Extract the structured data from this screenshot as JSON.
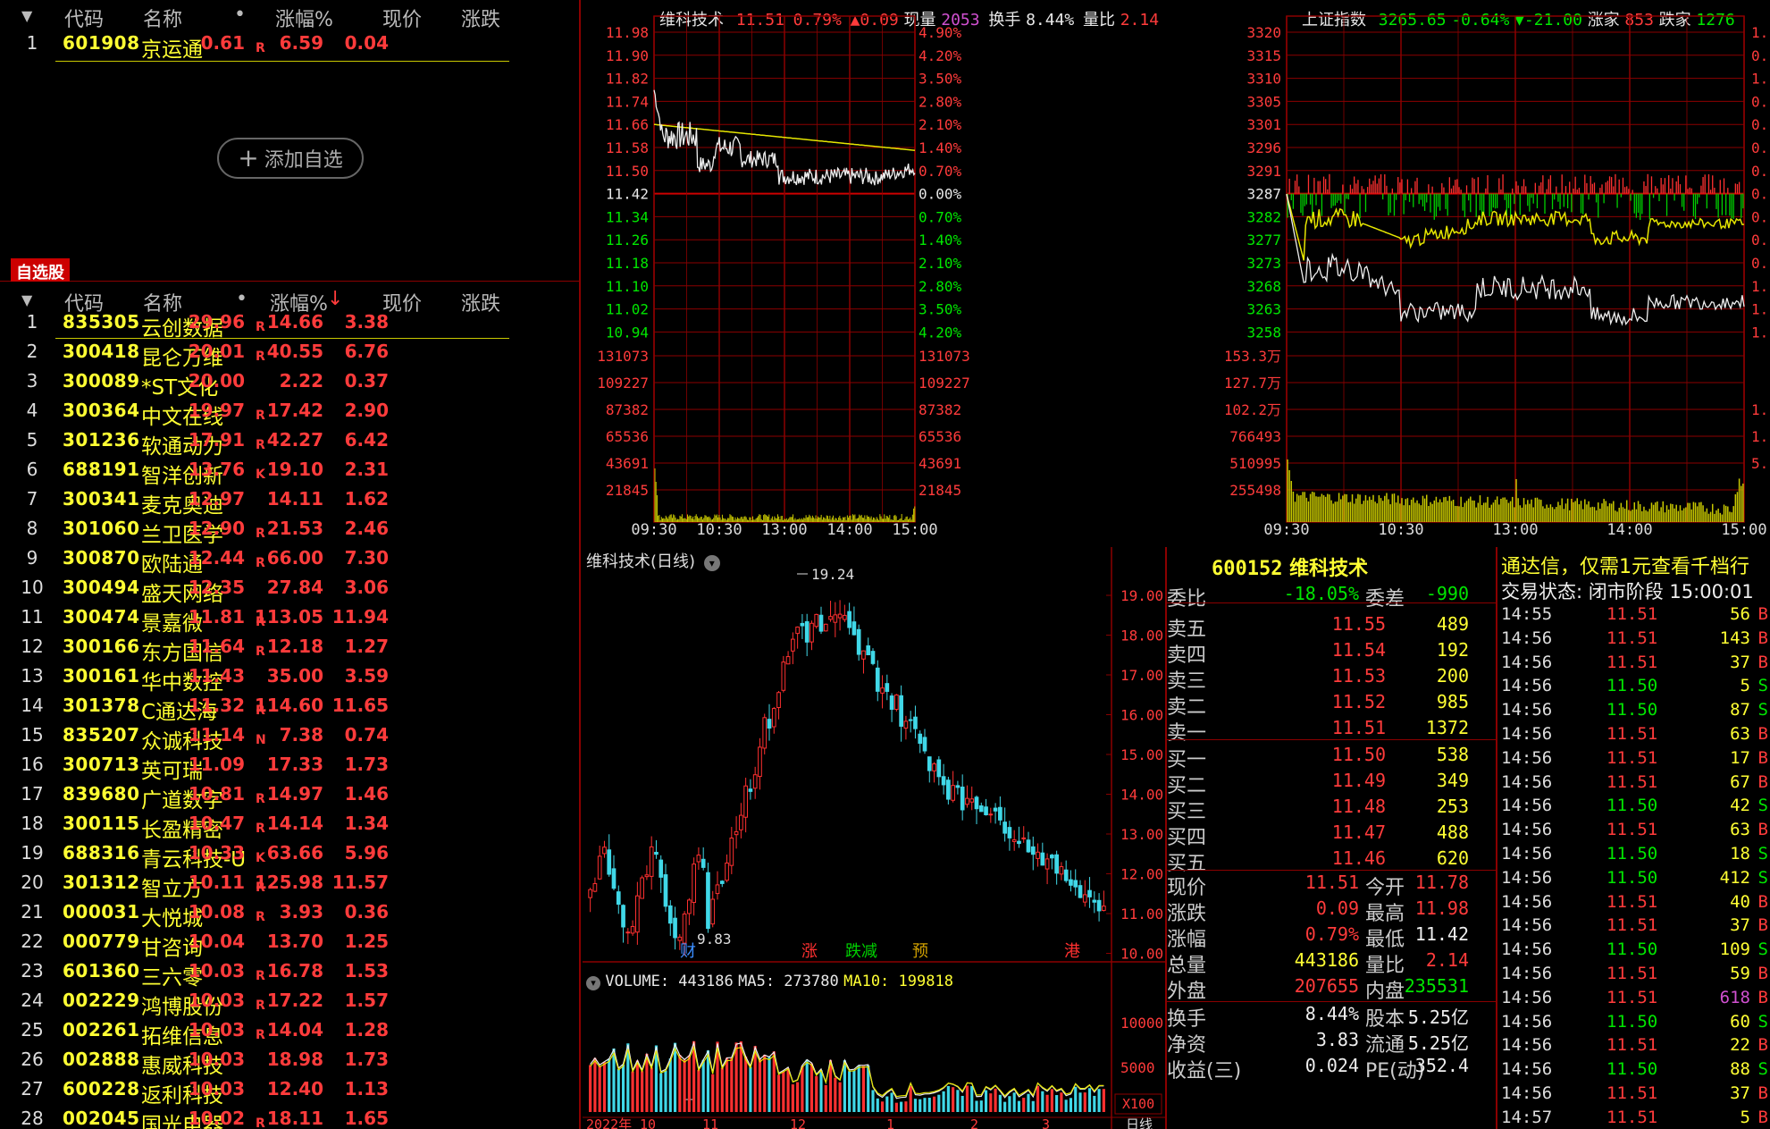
{
  "watch_top": {
    "headers": [
      "代码",
      "名称",
      "•",
      "涨幅%",
      "现价",
      "涨跌"
    ],
    "rows": [
      {
        "idx": "1",
        "code": "601908",
        "name": "京运通",
        "flag": "R",
        "pct": "0.61",
        "price": "6.59",
        "chg": "0.04"
      }
    ],
    "add_label": "添加自选"
  },
  "watchlist": {
    "tab_label": "自选股",
    "headers": [
      "代码",
      "名称",
      "•",
      "涨幅%",
      "现价",
      "涨跌"
    ],
    "sort_arrow": "↓",
    "rows": [
      {
        "idx": "1",
        "code": "835305",
        "name": "云创数据",
        "flag": "R",
        "pct": "29.96",
        "price": "14.66",
        "chg": "3.38"
      },
      {
        "idx": "2",
        "code": "300418",
        "name": "昆仑万维",
        "flag": "R",
        "pct": "20.01",
        "price": "40.55",
        "chg": "6.76"
      },
      {
        "idx": "3",
        "code": "300089",
        "name": "*ST文化",
        "flag": "",
        "pct": "20.00",
        "price": "2.22",
        "chg": "0.37"
      },
      {
        "idx": "4",
        "code": "300364",
        "name": "中文在线",
        "flag": "R",
        "pct": "19.97",
        "price": "17.42",
        "chg": "2.90"
      },
      {
        "idx": "5",
        "code": "301236",
        "name": "软通动力",
        "flag": "R",
        "pct": "17.91",
        "price": "42.27",
        "chg": "6.42"
      },
      {
        "idx": "6",
        "code": "688191",
        "name": "智洋创新",
        "flag": "K",
        "pct": "13.76",
        "price": "19.10",
        "chg": "2.31"
      },
      {
        "idx": "7",
        "code": "300341",
        "name": "麦克奥迪",
        "flag": "",
        "pct": "12.97",
        "price": "14.11",
        "chg": "1.62"
      },
      {
        "idx": "8",
        "code": "301060",
        "name": "兰卫医学",
        "flag": "R",
        "pct": "12.90",
        "price": "21.53",
        "chg": "2.46"
      },
      {
        "idx": "9",
        "code": "300870",
        "name": "欧陆通",
        "flag": "R",
        "pct": "12.44",
        "price": "66.00",
        "chg": "7.30"
      },
      {
        "idx": "10",
        "code": "300494",
        "name": "盛天网络",
        "flag": "",
        "pct": "12.35",
        "price": "27.84",
        "chg": "3.06"
      },
      {
        "idx": "11",
        "code": "300474",
        "name": "景嘉微",
        "flag": "R",
        "pct": "11.81",
        "price": "113.05",
        "chg": "11.94"
      },
      {
        "idx": "12",
        "code": "300166",
        "name": "东方国信",
        "flag": "R",
        "pct": "11.64",
        "price": "12.18",
        "chg": "1.27"
      },
      {
        "idx": "13",
        "code": "300161",
        "name": "华中数控",
        "flag": "",
        "pct": "11.43",
        "price": "35.00",
        "chg": "3.59"
      },
      {
        "idx": "14",
        "code": "301378",
        "name": "C通达海",
        "flag": "R",
        "pct": "11.32",
        "price": "114.60",
        "chg": "11.65"
      },
      {
        "idx": "15",
        "code": "835207",
        "name": "众诚科技",
        "flag": "N",
        "pct": "11.14",
        "price": "7.38",
        "chg": "0.74"
      },
      {
        "idx": "16",
        "code": "300713",
        "name": "英可瑞",
        "flag": "",
        "pct": "11.09",
        "price": "17.33",
        "chg": "1.73"
      },
      {
        "idx": "17",
        "code": "839680",
        "name": "广道数字",
        "flag": "R",
        "pct": "10.81",
        "price": "14.97",
        "chg": "1.46"
      },
      {
        "idx": "18",
        "code": "300115",
        "name": "长盈精密",
        "flag": "R",
        "pct": "10.47",
        "price": "14.14",
        "chg": "1.34"
      },
      {
        "idx": "19",
        "code": "688316",
        "name": "青云科技-U",
        "flag": "K",
        "pct": "10.33",
        "price": "63.66",
        "chg": "5.96"
      },
      {
        "idx": "20",
        "code": "301312",
        "name": "智立方",
        "flag": "R",
        "pct": "10.11",
        "price": "125.98",
        "chg": "11.57"
      },
      {
        "idx": "21",
        "code": "000031",
        "name": "大悦城",
        "flag": "R",
        "pct": "10.08",
        "price": "3.93",
        "chg": "0.36"
      },
      {
        "idx": "22",
        "code": "000779",
        "name": "甘咨询",
        "flag": "",
        "pct": "10.04",
        "price": "13.70",
        "chg": "1.25"
      },
      {
        "idx": "23",
        "code": "601360",
        "name": "三六零",
        "flag": "R",
        "pct": "10.03",
        "price": "16.78",
        "chg": "1.53"
      },
      {
        "idx": "24",
        "code": "002229",
        "name": "鸿博股份",
        "flag": "R",
        "pct": "10.03",
        "price": "17.22",
        "chg": "1.57"
      },
      {
        "idx": "25",
        "code": "002261",
        "name": "拓维信息",
        "flag": "R",
        "pct": "10.03",
        "price": "14.04",
        "chg": "1.28"
      },
      {
        "idx": "26",
        "code": "002888",
        "name": "惠威科技",
        "flag": "",
        "pct": "10.03",
        "price": "18.98",
        "chg": "1.73"
      },
      {
        "idx": "27",
        "code": "600228",
        "name": "返利科技",
        "flag": "",
        "pct": "10.03",
        "price": "12.40",
        "chg": "1.13"
      },
      {
        "idx": "28",
        "code": "002045",
        "name": "国光电器",
        "flag": "R",
        "pct": "10.02",
        "price": "18.11",
        "chg": "1.65"
      }
    ]
  },
  "intraday": {
    "name": "维科技术",
    "price": "11.51",
    "pct": "0.79%",
    "chg": "▲0.09",
    "xianliang_label": "现量",
    "xianliang": "2053",
    "huanshou_label": "换手",
    "huanshou": "8.44%",
    "liangbi_label": "量比",
    "liangbi": "2.14",
    "price_ticks": [
      "11.98",
      "11.90",
      "11.82",
      "11.74",
      "11.66",
      "11.58",
      "11.50",
      "11.42",
      "11.34",
      "11.26",
      "11.18",
      "11.10",
      "11.02",
      "10.94"
    ],
    "pct_ticks": [
      "4.90%",
      "4.20%",
      "3.50%",
      "2.80%",
      "2.10%",
      "1.40%",
      "0.70%",
      "0.00%",
      "0.70%",
      "1.40%",
      "2.10%",
      "2.80%",
      "3.50%",
      "4.20%"
    ],
    "vol_ticks": [
      "131073",
      "109227",
      "87382",
      "65536",
      "43691",
      "21845"
    ],
    "time_ticks": [
      "09:30",
      "10:30",
      "13:00",
      "14:00",
      "15:00"
    ]
  },
  "index_chart": {
    "name": "上证指数",
    "value": "3265.65",
    "pct": "-0.64%",
    "chg": "▼-21.00",
    "up_label": "涨家",
    "up": "853",
    "down_label": "跌家",
    "down": "1276",
    "price_ticks": [
      "3320",
      "3315",
      "3310",
      "3305",
      "3301",
      "3296",
      "3291",
      "3287",
      "3282",
      "3277",
      "3273",
      "3268",
      "3263",
      "3258"
    ],
    "vol_ticks": [
      "153.3万",
      "127.7万",
      "102.2万",
      "766493",
      "510995",
      "255498"
    ],
    "time_ticks": [
      "09:30",
      "10:30",
      "13:00",
      "14:00",
      "15:00"
    ],
    "right_ticks": [
      "1.",
      "0.",
      "1.",
      "0.",
      "0.",
      "0.",
      "0.",
      "0.",
      "0.",
      "0.",
      "0.",
      "1.",
      "1.",
      "1.",
      "1.",
      "1.",
      "5."
    ]
  },
  "kline": {
    "title": "维科技术(日线)",
    "high_label": "19.24",
    "low_label": "9.83",
    "y_ticks": [
      "19.00",
      "18.00",
      "17.00",
      "16.00",
      "15.00",
      "14.00",
      "13.00",
      "12.00",
      "11.00",
      "10.00"
    ],
    "events": [
      "财",
      "涨",
      "跌减",
      "预",
      "港"
    ],
    "volume_title": "VOLUME: 443186",
    "ma5": "MA5: 273780",
    "ma10": "MA10: 199818",
    "vol_ticks": [
      "10000",
      "5000"
    ],
    "vol_unit": "X100",
    "x_ticks": [
      "2022年",
      "10",
      "11",
      "12",
      "1",
      "2",
      "3"
    ],
    "period_label": "日线"
  },
  "orderbook": {
    "title_code": "600152",
    "title_name": "维科技术",
    "weibi_label": "委比",
    "weibi": "-18.05%",
    "weicha_label": "委差",
    "weicha": "-990",
    "asks": [
      {
        "label": "卖五",
        "price": "11.55",
        "vol": "489"
      },
      {
        "label": "卖四",
        "price": "11.54",
        "vol": "192"
      },
      {
        "label": "卖三",
        "price": "11.53",
        "vol": "200"
      },
      {
        "label": "卖二",
        "price": "11.52",
        "vol": "985"
      },
      {
        "label": "卖一",
        "price": "11.51",
        "vol": "1372"
      }
    ],
    "bids": [
      {
        "label": "买一",
        "price": "11.50",
        "vol": "538"
      },
      {
        "label": "买二",
        "price": "11.49",
        "vol": "349"
      },
      {
        "label": "买三",
        "price": "11.48",
        "vol": "253"
      },
      {
        "label": "买四",
        "price": "11.47",
        "vol": "488"
      },
      {
        "label": "买五",
        "price": "11.46",
        "vol": "620"
      }
    ],
    "stats": [
      {
        "l1": "现价",
        "v1": "11.51",
        "c1": "red",
        "l2": "今开",
        "v2": "11.78",
        "c2": "red"
      },
      {
        "l1": "涨跌",
        "v1": "0.09",
        "c1": "red",
        "l2": "最高",
        "v2": "11.98",
        "c2": "red"
      },
      {
        "l1": "涨幅",
        "v1": "0.79%",
        "c1": "red",
        "l2": "最低",
        "v2": "11.42",
        "c2": "white"
      },
      {
        "l1": "总量",
        "v1": "443186",
        "c1": "yellow",
        "l2": "量比",
        "v2": "2.14",
        "c2": "red"
      },
      {
        "l1": "外盘",
        "v1": "207655",
        "c1": "red",
        "l2": "内盘",
        "v2": "235531",
        "c2": "green"
      }
    ],
    "fund": [
      {
        "l1": "换手",
        "v1": "8.44%",
        "l2": "股本",
        "v2": "5.25亿"
      },
      {
        "l1": "净资",
        "v1": "3.83",
        "l2": "流通",
        "v2": "5.25亿"
      },
      {
        "l1": "收益(三)",
        "v1": "0.024",
        "l2": "PE(动)",
        "v2": "352.4"
      }
    ]
  },
  "ticks": {
    "promo": "通达信，仅需1元查看千档行",
    "status": "交易状态: 闭市阶段 15:00:01",
    "rows": [
      {
        "t": "14:55",
        "p": "11.51",
        "v": "56",
        "bs": "B"
      },
      {
        "t": "14:56",
        "p": "11.51",
        "v": "143",
        "bs": "B"
      },
      {
        "t": "14:56",
        "p": "11.51",
        "v": "37",
        "bs": "B"
      },
      {
        "t": "14:56",
        "p": "11.50",
        "v": "5",
        "bs": "S"
      },
      {
        "t": "14:56",
        "p": "11.50",
        "v": "87",
        "bs": "S"
      },
      {
        "t": "14:56",
        "p": "11.51",
        "v": "63",
        "bs": "B"
      },
      {
        "t": "14:56",
        "p": "11.51",
        "v": "17",
        "bs": "B"
      },
      {
        "t": "14:56",
        "p": "11.51",
        "v": "67",
        "bs": "B"
      },
      {
        "t": "14:56",
        "p": "11.50",
        "v": "42",
        "bs": "S"
      },
      {
        "t": "14:56",
        "p": "11.51",
        "v": "63",
        "bs": "B"
      },
      {
        "t": "14:56",
        "p": "11.50",
        "v": "18",
        "bs": "S"
      },
      {
        "t": "14:56",
        "p": "11.50",
        "v": "412",
        "bs": "S"
      },
      {
        "t": "14:56",
        "p": "11.51",
        "v": "40",
        "bs": "B"
      },
      {
        "t": "14:56",
        "p": "11.51",
        "v": "37",
        "bs": "B"
      },
      {
        "t": "14:56",
        "p": "11.50",
        "v": "109",
        "bs": "S"
      },
      {
        "t": "14:56",
        "p": "11.51",
        "v": "59",
        "bs": "B"
      },
      {
        "t": "14:56",
        "p": "11.51",
        "v": "618",
        "bs": "B"
      },
      {
        "t": "14:56",
        "p": "11.50",
        "v": "60",
        "bs": "S"
      },
      {
        "t": "14:56",
        "p": "11.51",
        "v": "22",
        "bs": "B"
      },
      {
        "t": "14:56",
        "p": "11.50",
        "v": "88",
        "bs": "S"
      },
      {
        "t": "14:56",
        "p": "11.51",
        "v": "37",
        "bs": "B"
      },
      {
        "t": "14:57",
        "p": "11.51",
        "v": "5",
        "bs": "B"
      }
    ]
  },
  "colors": {
    "up": "#ff3b3b",
    "down": "#00e600",
    "grid": "#8b0000",
    "name": "#ffff33",
    "bg": "#000000"
  }
}
